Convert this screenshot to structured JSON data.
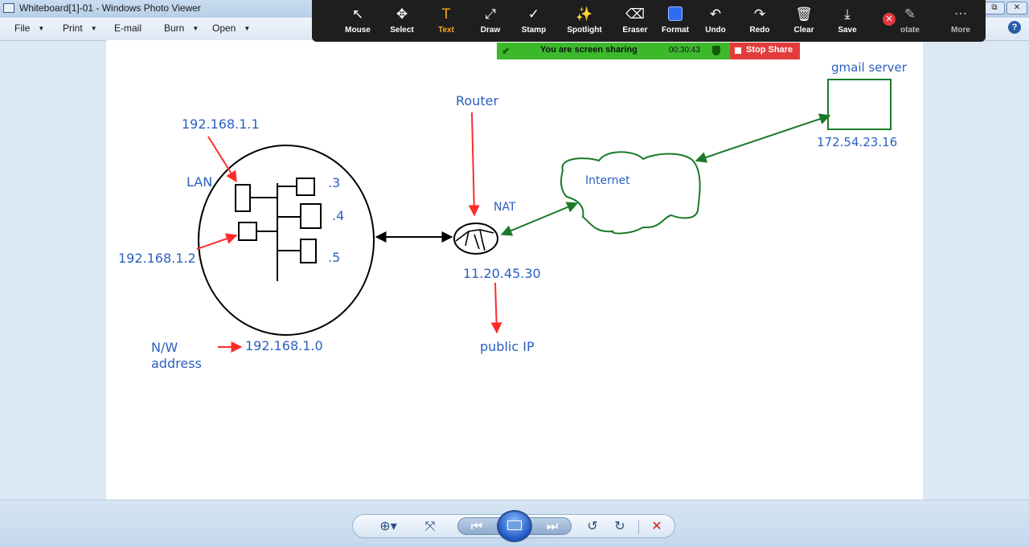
{
  "window": {
    "title": "Whiteboard[1]-01 - Windows Photo Viewer",
    "controls": {
      "minimize": "🗗",
      "restore": "⧉",
      "close": "✕"
    }
  },
  "menu": [
    {
      "label": "File",
      "has_dropdown": true
    },
    {
      "label": "Print",
      "has_dropdown": true
    },
    {
      "label": "E-mail",
      "has_dropdown": false
    },
    {
      "label": "Burn",
      "has_dropdown": true
    },
    {
      "label": "Open",
      "has_dropdown": true
    }
  ],
  "menu_caret": "▼",
  "help_icon": "?",
  "zoom_toolbar": {
    "tools": [
      {
        "label": "Mouse",
        "icon": "↖"
      },
      {
        "label": "Select",
        "icon": "✥"
      },
      {
        "label": "Text",
        "icon": "T",
        "active": true
      },
      {
        "label": "Draw",
        "icon": "⤢"
      },
      {
        "label": "Stamp",
        "icon": "✓"
      },
      {
        "label": "Spotlight",
        "icon": "✨"
      },
      {
        "label": "Eraser",
        "icon": "⌫"
      },
      {
        "label": "Format",
        "icon": "swatch"
      },
      {
        "label": "Undo",
        "icon": "↶"
      },
      {
        "label": "Redo",
        "icon": "↷"
      },
      {
        "label": "Clear",
        "icon": "🗑"
      },
      {
        "label": "Save",
        "icon": "⤓"
      }
    ],
    "close_icon": "✕",
    "partial_tool": {
      "label": "otate",
      "icon": "✎"
    },
    "more": {
      "label": "More",
      "icon": "···"
    }
  },
  "share_banner": {
    "status": "You are screen sharing",
    "timer": "00:30:43",
    "stop_label": "Stop Share",
    "arrow_icon": "⬋"
  },
  "diagram": {
    "labels": {
      "ip1": "192.168.1.1",
      "lan": "LAN",
      "ip2": "192.168.1.2",
      "host3": ".3",
      "host4": ".4",
      "host5": ".5",
      "nw_line1": "N/W",
      "nw_line2": "address",
      "nw_ip": "192.168.1.0",
      "router": "Router",
      "nat": "NAT",
      "public_ip_value": "11.20.45.30",
      "public_ip": "public IP",
      "internet": "Internet",
      "gmail_server": "gmail server",
      "gmail_ip": "172.54.23.16"
    },
    "colors": {
      "ink": "#000000",
      "red": "#ff2a2a",
      "green": "#1a7a2a",
      "blue_text": "#2b5fc1"
    }
  },
  "bottom_controls": {
    "zoom": "⊕▾",
    "fit": "⤧",
    "prev": "⏮",
    "next": "⏭",
    "rotate_left": "↺",
    "rotate_right": "↻",
    "delete": "✕"
  }
}
